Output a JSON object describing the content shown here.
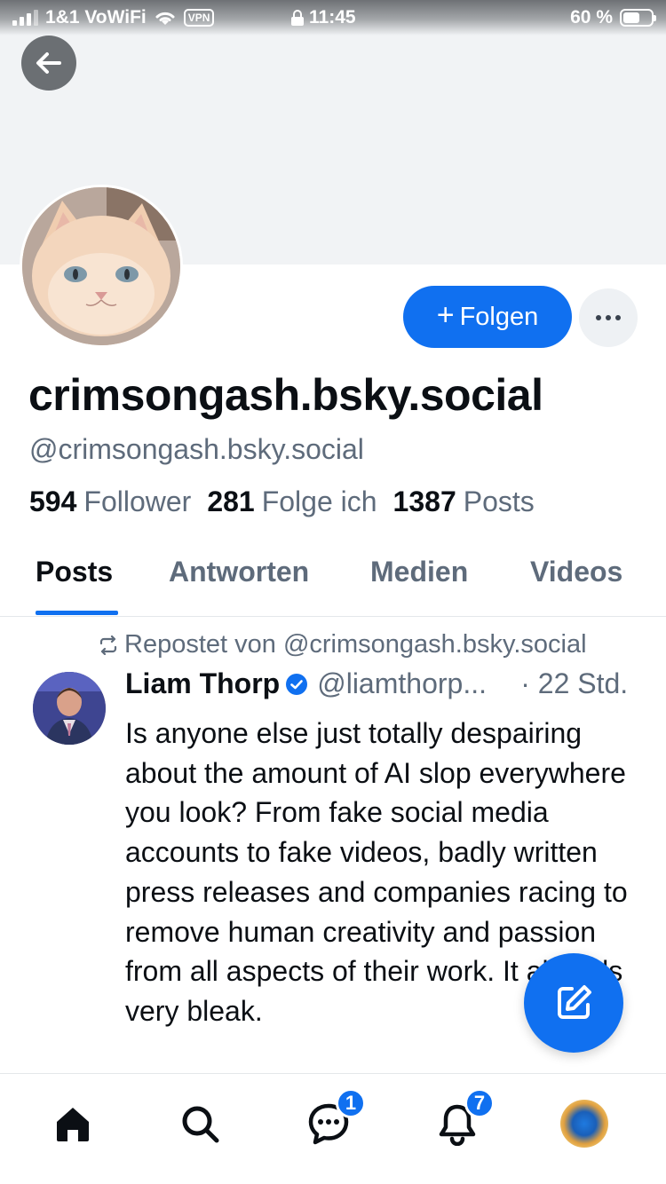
{
  "status_bar": {
    "carrier": "1&1 VoWiFi",
    "vpn": "VPN",
    "time": "11:45",
    "battery": "60 %"
  },
  "profile": {
    "display_name": "crimsongash.bsky.social",
    "handle": "@crimsongash.bsky.social",
    "follow_label": "Folgen",
    "follow_icon": "plus-icon",
    "more_icon": "ellipsis-icon",
    "stats": [
      {
        "value": "594",
        "label": "Follower"
      },
      {
        "value": "281",
        "label": "Folge ich"
      },
      {
        "value": "1387",
        "label": "Posts"
      }
    ]
  },
  "tabs": [
    {
      "label": "Posts",
      "active": true
    },
    {
      "label": "Antworten",
      "active": false
    },
    {
      "label": "Medien",
      "active": false
    },
    {
      "label": "Videos",
      "active": false
    }
  ],
  "post": {
    "repost_label": "Repostet von @crimsongash.bsky.social",
    "author": "Liam Thorp",
    "author_handle": "@liamthorp...",
    "time": "· 22 Std.",
    "text": "Is anyone else just totally despairing about the amount of AI slop everywhere you look? From fake social media accounts to fake videos, badly written press releases and companies racing to remove human creativity and passion from all aspects of their work. It all feels very bleak."
  },
  "bottom_nav": {
    "items": [
      {
        "icon": "home-icon"
      },
      {
        "icon": "search-icon"
      },
      {
        "icon": "chat-icon",
        "badge": "1"
      },
      {
        "icon": "bell-icon",
        "badge": "7"
      },
      {
        "icon": "profile-avatar"
      }
    ]
  },
  "colors": {
    "accent": "#1070f0",
    "muted_text": "#5e6b7b",
    "banner": "#f1f3f5"
  }
}
